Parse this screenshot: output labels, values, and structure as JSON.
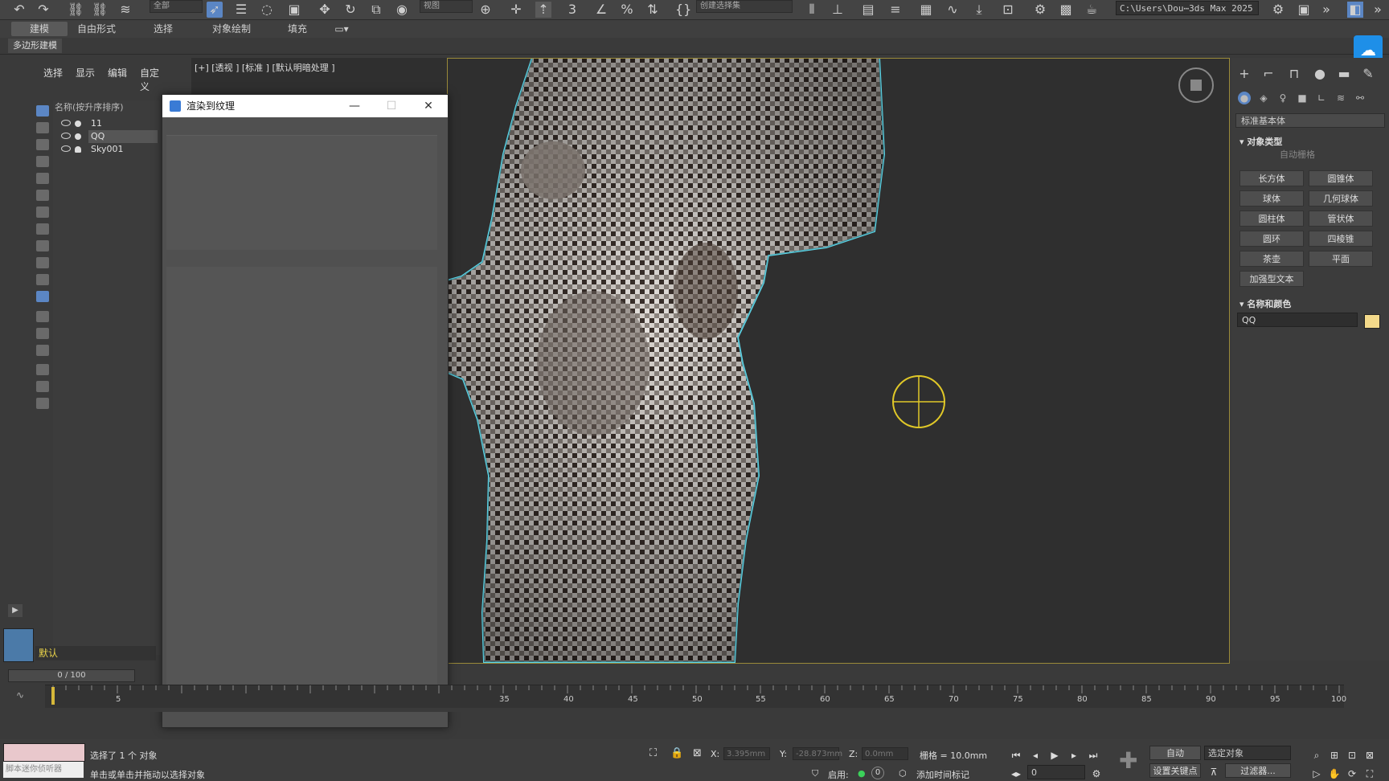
{
  "toolbar": {
    "selection_filter": "全部",
    "ref_coord": "视图",
    "named_selection": "创建选择集",
    "project_path": "C:\\Users\\Dou⋯3ds Max 2025",
    "icons": [
      "undo-icon",
      "redo-icon",
      "link-icon",
      "unlink-icon",
      "bind-space-warp-icon",
      "select-object-icon",
      "select-by-name-icon",
      "lasso-region-icon",
      "window-crossing-icon",
      "select-move-icon",
      "select-rotate-icon",
      "select-scale-icon",
      "placement-icon",
      "snap-3d-icon",
      "angle-snap-icon",
      "percent-snap-icon",
      "spinner-snap-icon",
      "edit-named-sel-icon",
      "mirror-icon",
      "align-icon",
      "layer-explorer-icon",
      "toggle-ribbon-icon",
      "curve-editor-icon",
      "schematic-view-icon",
      "material-editor-icon",
      "render-setup-icon",
      "rendered-frame-icon",
      "render-icon"
    ]
  },
  "ribbon": {
    "tabs": [
      "建模",
      "自由形式",
      "选择",
      "对象绘制",
      "填充"
    ],
    "active_tab": "建模",
    "sub_label": "多边形建模"
  },
  "explorer": {
    "menu": [
      "选择",
      "显示",
      "编辑",
      "自定义"
    ],
    "header": "名称(按升序排序)",
    "rows": [
      {
        "name": "11",
        "kind": "geometry"
      },
      {
        "name": "QQ",
        "kind": "geometry",
        "selected": true
      },
      {
        "name": "Sky001",
        "kind": "light"
      }
    ],
    "layer": "默认",
    "frame": "0 / 100"
  },
  "viewport": {
    "label": "[+] [透视 ] [标准 ] [默认明暗处理 ]",
    "accent_outline": "#5fd6e8",
    "selection_border": "#9a8a3a"
  },
  "dialog": {
    "title": "渲染到纹理"
  },
  "command_panel": {
    "category": "标准基本体",
    "section_object_type": "对象类型",
    "auto_grid": "自动栅格",
    "buttons": [
      "长方体",
      "圆锥体",
      "球体",
      "几何球体",
      "圆柱体",
      "管状体",
      "圆环",
      "四棱锥",
      "茶壶",
      "平面",
      "加强型文本"
    ],
    "section_name_color": "名称和颜色",
    "object_name": "QQ",
    "object_color": "#f3d98a"
  },
  "timeline": {
    "ticks": [
      "5",
      "35",
      "40",
      "45",
      "50",
      "55",
      "60",
      "65",
      "70",
      "75",
      "80",
      "85",
      "90",
      "95",
      "100"
    ]
  },
  "statusbar": {
    "maxscript_hint": "脚本迷你侦听器",
    "selected_text": "选择了 1 个 对象",
    "prompt_text": "单击或单击并拖动以选择对象",
    "x_label": "X:",
    "x_value": "3.395mm",
    "y_label": "Y:",
    "y_value": "-28.873mm",
    "z_label": "Z:",
    "z_value": "0.0mm",
    "grid_text": "栅格 = 10.0mm",
    "enable_text": "启用:",
    "enable_value": "0",
    "add_tag": "添加时间标记",
    "auto_key": "自动",
    "set_key": "设置关键点",
    "selected_object_dd": "选定对象",
    "filter_btn": "过滤器...",
    "frame_field": "0"
  }
}
